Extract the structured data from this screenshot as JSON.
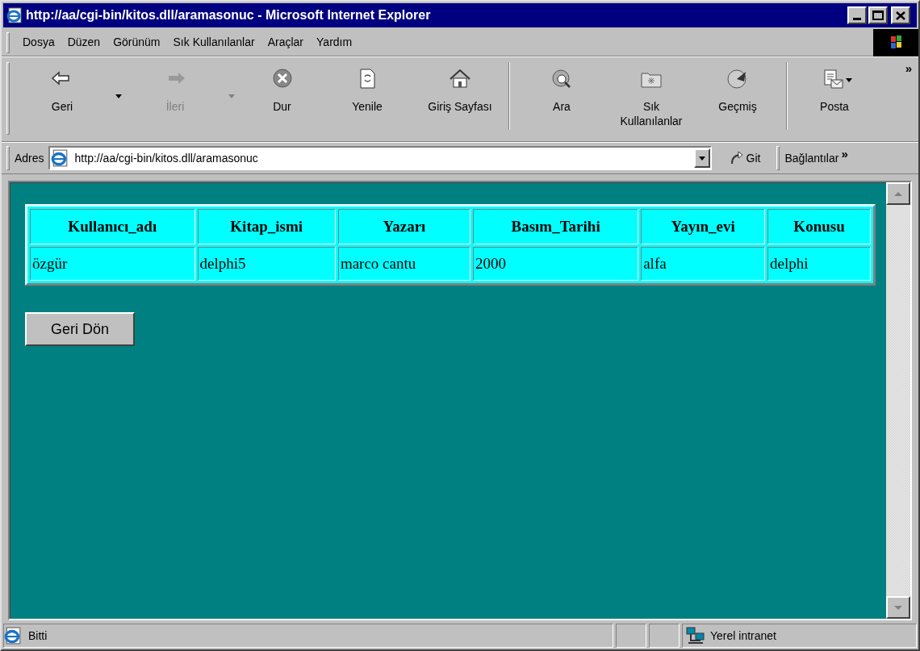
{
  "window": {
    "title": "http://aa/cgi-bin/kitos.dll/aramasonuc - Microsoft Internet Explorer"
  },
  "menu": [
    "Dosya",
    "Düzen",
    "Görünüm",
    "Sık Kullanılanlar",
    "Araçlar",
    "Yardım"
  ],
  "toolbar": {
    "items": [
      {
        "kind": "button",
        "label": "Geri",
        "disabled": false,
        "dropdown": true
      },
      {
        "kind": "button",
        "label": "İleri",
        "disabled": true,
        "dropdown": true
      },
      {
        "kind": "button",
        "label": "Dur",
        "disabled": false,
        "dropdown": false
      },
      {
        "kind": "button",
        "label": "Yenile",
        "disabled": false,
        "dropdown": false
      },
      {
        "kind": "button",
        "label": "Giriş Sayfası",
        "disabled": false,
        "dropdown": false
      },
      {
        "kind": "separator"
      },
      {
        "kind": "button",
        "label": "Ara",
        "disabled": false,
        "dropdown": false
      },
      {
        "kind": "button",
        "label": "Sık Kullanılanlar",
        "disabled": false,
        "dropdown": false
      },
      {
        "kind": "button",
        "label": "Geçmiş",
        "disabled": false,
        "dropdown": false
      },
      {
        "kind": "separator"
      },
      {
        "kind": "button",
        "label": "Posta",
        "disabled": false,
        "dropdown": true
      }
    ],
    "more": "»"
  },
  "address_bar": {
    "label": "Adres",
    "value": "http://aa/cgi-bin/kitos.dll/aramasonuc",
    "go": "Git",
    "links": "Bağlantılar",
    "links_more": "»"
  },
  "table": {
    "columns": [
      "Kullanıcı_adı",
      "Kitap_ismi",
      "Yazarı",
      "Basım_Tarihi",
      "Yayın_evi",
      "Konusu"
    ],
    "rows": [
      [
        "özgür",
        "delphi5",
        "marco cantu",
        "2000",
        "alfa",
        "delphi"
      ]
    ]
  },
  "back_button": "Geri Dön",
  "status_bar": {
    "text": "Bitti",
    "zone": "Yerel intranet"
  }
}
